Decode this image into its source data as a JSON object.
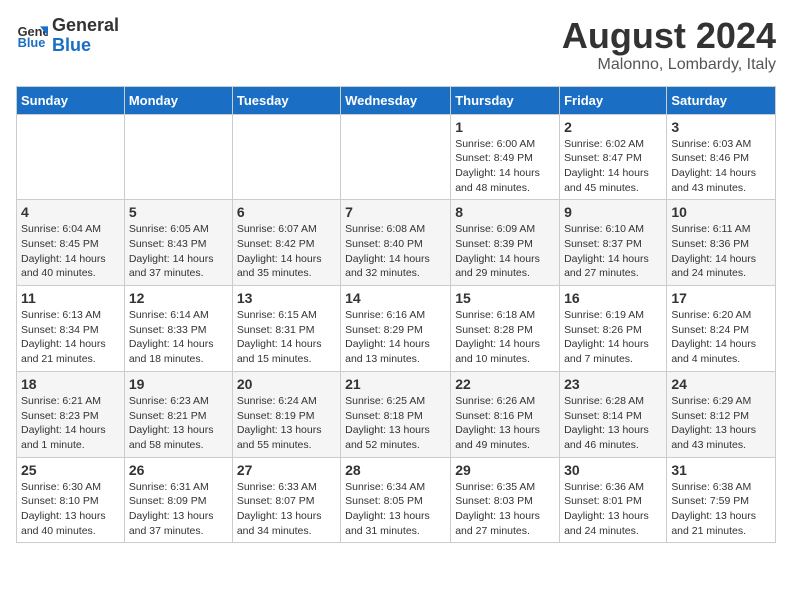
{
  "header": {
    "logo_line1": "General",
    "logo_line2": "Blue",
    "month_year": "August 2024",
    "location": "Malonno, Lombardy, Italy"
  },
  "weekdays": [
    "Sunday",
    "Monday",
    "Tuesday",
    "Wednesday",
    "Thursday",
    "Friday",
    "Saturday"
  ],
  "weeks": [
    [
      {
        "day": "",
        "info": ""
      },
      {
        "day": "",
        "info": ""
      },
      {
        "day": "",
        "info": ""
      },
      {
        "day": "",
        "info": ""
      },
      {
        "day": "1",
        "info": "Sunrise: 6:00 AM\nSunset: 8:49 PM\nDaylight: 14 hours\nand 48 minutes."
      },
      {
        "day": "2",
        "info": "Sunrise: 6:02 AM\nSunset: 8:47 PM\nDaylight: 14 hours\nand 45 minutes."
      },
      {
        "day": "3",
        "info": "Sunrise: 6:03 AM\nSunset: 8:46 PM\nDaylight: 14 hours\nand 43 minutes."
      }
    ],
    [
      {
        "day": "4",
        "info": "Sunrise: 6:04 AM\nSunset: 8:45 PM\nDaylight: 14 hours\nand 40 minutes."
      },
      {
        "day": "5",
        "info": "Sunrise: 6:05 AM\nSunset: 8:43 PM\nDaylight: 14 hours\nand 37 minutes."
      },
      {
        "day": "6",
        "info": "Sunrise: 6:07 AM\nSunset: 8:42 PM\nDaylight: 14 hours\nand 35 minutes."
      },
      {
        "day": "7",
        "info": "Sunrise: 6:08 AM\nSunset: 8:40 PM\nDaylight: 14 hours\nand 32 minutes."
      },
      {
        "day": "8",
        "info": "Sunrise: 6:09 AM\nSunset: 8:39 PM\nDaylight: 14 hours\nand 29 minutes."
      },
      {
        "day": "9",
        "info": "Sunrise: 6:10 AM\nSunset: 8:37 PM\nDaylight: 14 hours\nand 27 minutes."
      },
      {
        "day": "10",
        "info": "Sunrise: 6:11 AM\nSunset: 8:36 PM\nDaylight: 14 hours\nand 24 minutes."
      }
    ],
    [
      {
        "day": "11",
        "info": "Sunrise: 6:13 AM\nSunset: 8:34 PM\nDaylight: 14 hours\nand 21 minutes."
      },
      {
        "day": "12",
        "info": "Sunrise: 6:14 AM\nSunset: 8:33 PM\nDaylight: 14 hours\nand 18 minutes."
      },
      {
        "day": "13",
        "info": "Sunrise: 6:15 AM\nSunset: 8:31 PM\nDaylight: 14 hours\nand 15 minutes."
      },
      {
        "day": "14",
        "info": "Sunrise: 6:16 AM\nSunset: 8:29 PM\nDaylight: 14 hours\nand 13 minutes."
      },
      {
        "day": "15",
        "info": "Sunrise: 6:18 AM\nSunset: 8:28 PM\nDaylight: 14 hours\nand 10 minutes."
      },
      {
        "day": "16",
        "info": "Sunrise: 6:19 AM\nSunset: 8:26 PM\nDaylight: 14 hours\nand 7 minutes."
      },
      {
        "day": "17",
        "info": "Sunrise: 6:20 AM\nSunset: 8:24 PM\nDaylight: 14 hours\nand 4 minutes."
      }
    ],
    [
      {
        "day": "18",
        "info": "Sunrise: 6:21 AM\nSunset: 8:23 PM\nDaylight: 14 hours\nand 1 minute."
      },
      {
        "day": "19",
        "info": "Sunrise: 6:23 AM\nSunset: 8:21 PM\nDaylight: 13 hours\nand 58 minutes."
      },
      {
        "day": "20",
        "info": "Sunrise: 6:24 AM\nSunset: 8:19 PM\nDaylight: 13 hours\nand 55 minutes."
      },
      {
        "day": "21",
        "info": "Sunrise: 6:25 AM\nSunset: 8:18 PM\nDaylight: 13 hours\nand 52 minutes."
      },
      {
        "day": "22",
        "info": "Sunrise: 6:26 AM\nSunset: 8:16 PM\nDaylight: 13 hours\nand 49 minutes."
      },
      {
        "day": "23",
        "info": "Sunrise: 6:28 AM\nSunset: 8:14 PM\nDaylight: 13 hours\nand 46 minutes."
      },
      {
        "day": "24",
        "info": "Sunrise: 6:29 AM\nSunset: 8:12 PM\nDaylight: 13 hours\nand 43 minutes."
      }
    ],
    [
      {
        "day": "25",
        "info": "Sunrise: 6:30 AM\nSunset: 8:10 PM\nDaylight: 13 hours\nand 40 minutes."
      },
      {
        "day": "26",
        "info": "Sunrise: 6:31 AM\nSunset: 8:09 PM\nDaylight: 13 hours\nand 37 minutes."
      },
      {
        "day": "27",
        "info": "Sunrise: 6:33 AM\nSunset: 8:07 PM\nDaylight: 13 hours\nand 34 minutes."
      },
      {
        "day": "28",
        "info": "Sunrise: 6:34 AM\nSunset: 8:05 PM\nDaylight: 13 hours\nand 31 minutes."
      },
      {
        "day": "29",
        "info": "Sunrise: 6:35 AM\nSunset: 8:03 PM\nDaylight: 13 hours\nand 27 minutes."
      },
      {
        "day": "30",
        "info": "Sunrise: 6:36 AM\nSunset: 8:01 PM\nDaylight: 13 hours\nand 24 minutes."
      },
      {
        "day": "31",
        "info": "Sunrise: 6:38 AM\nSunset: 7:59 PM\nDaylight: 13 hours\nand 21 minutes."
      }
    ]
  ]
}
